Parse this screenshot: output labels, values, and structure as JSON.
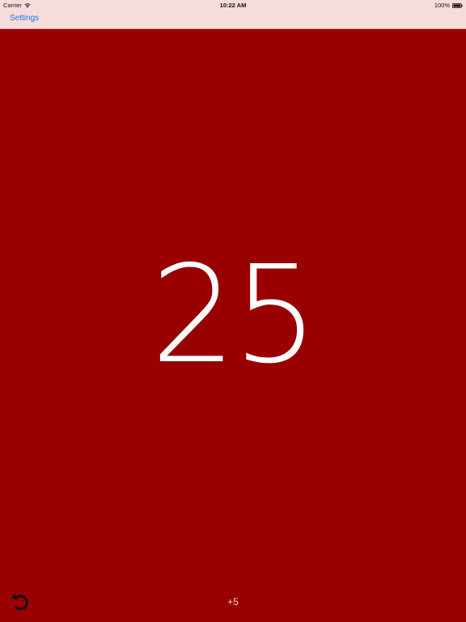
{
  "status_bar": {
    "carrier": "Carrier",
    "time": "10:22 AM",
    "battery": "100%"
  },
  "nav": {
    "settings_label": "Settings"
  },
  "counter": {
    "value": "25"
  },
  "footer": {
    "increment_label": "+5"
  },
  "colors": {
    "background": "#990000",
    "nav_background": "#f7dcdc",
    "accent": "#1478f0",
    "counter_text": "#ffffff"
  },
  "icons": {
    "wifi": "wifi-icon",
    "battery": "battery-icon",
    "reset": "reset-icon"
  }
}
